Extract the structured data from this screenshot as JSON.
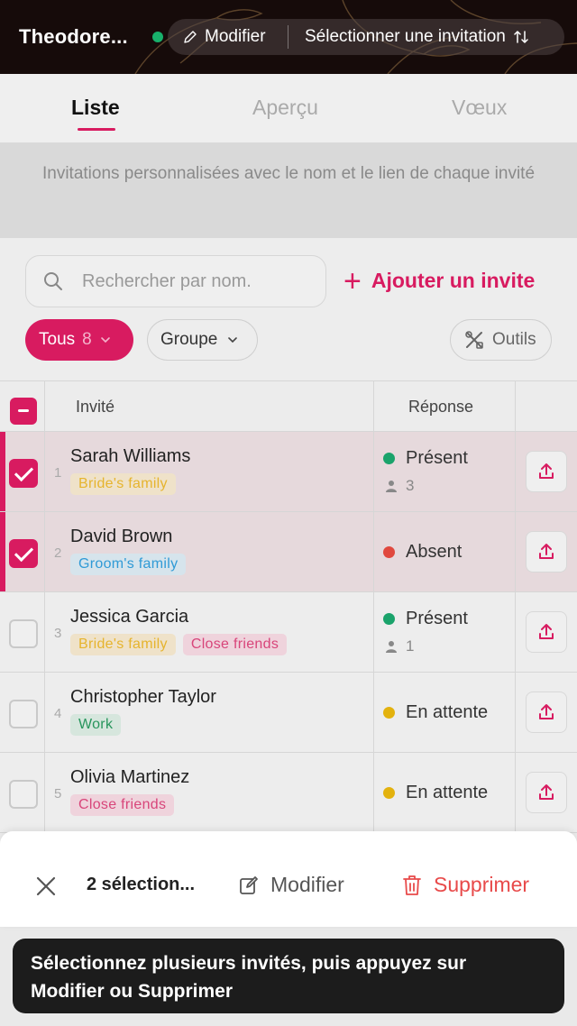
{
  "header": {
    "title": "Theodore...",
    "edit_label": "Modifier",
    "select_invitation_label": "Sélectionner une invitation"
  },
  "tabs": [
    {
      "label": "Liste",
      "active": true
    },
    {
      "label": "Aperçu",
      "active": false
    },
    {
      "label": "Vœux",
      "active": false
    }
  ],
  "description": "Invitations personnalisées avec le nom et le lien de chaque invité",
  "search": {
    "placeholder": "Rechercher par nom."
  },
  "add_guest_label": "Ajouter un invite",
  "filters": {
    "all_label": "Tous",
    "all_count": "8",
    "group_label": "Groupe",
    "tools_label": "Outils"
  },
  "table": {
    "headers": {
      "guest": "Invité",
      "response": "Réponse"
    },
    "rows": [
      {
        "index": "1",
        "name": "Sarah Williams",
        "selected": true,
        "tags": [
          {
            "label": "Bride's family",
            "kind": "bride"
          }
        ],
        "status": "Présent",
        "status_color": "#1aa36b",
        "guests": "3"
      },
      {
        "index": "2",
        "name": "David Brown",
        "selected": true,
        "tags": [
          {
            "label": "Groom's family",
            "kind": "groom"
          }
        ],
        "status": "Absent",
        "status_color": "#e0483e",
        "guests": ""
      },
      {
        "index": "3",
        "name": "Jessica Garcia",
        "selected": false,
        "tags": [
          {
            "label": "Bride's family",
            "kind": "bride"
          },
          {
            "label": "Close friends",
            "kind": "friends"
          }
        ],
        "status": "Présent",
        "status_color": "#1aa36b",
        "guests": "1"
      },
      {
        "index": "4",
        "name": "Christopher Taylor",
        "selected": false,
        "tags": [
          {
            "label": "Work",
            "kind": "work"
          }
        ],
        "status": "En attente",
        "status_color": "#e3b20e",
        "guests": ""
      },
      {
        "index": "5",
        "name": "Olivia Martinez",
        "selected": false,
        "tags": [
          {
            "label": "Close friends",
            "kind": "friends"
          }
        ],
        "status": "En attente",
        "status_color": "#e3b20e",
        "guests": ""
      }
    ]
  },
  "action_bar": {
    "selection_label": "2 sélection...",
    "edit_label": "Modifier",
    "delete_label": "Supprimer"
  },
  "toast": {
    "line1": "Sélectionnez plusieurs invités, puis appuyez sur",
    "line2": "Modifier ou Supprimer"
  },
  "colors": {
    "accent": "#d81b60",
    "danger": "#e84a4a",
    "present": "#1aa36b",
    "absent": "#e0483e",
    "pending": "#e3b20e"
  }
}
